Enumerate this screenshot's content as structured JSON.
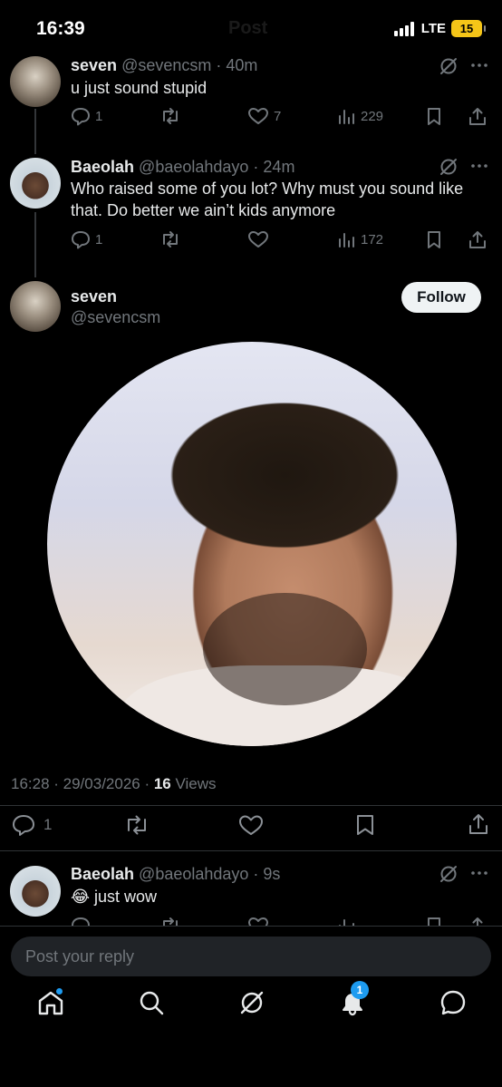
{
  "status_bar": {
    "time": "16:39",
    "network": "LTE",
    "battery": "15",
    "ghost_title": "Post"
  },
  "tweets": [
    {
      "name": "seven",
      "handle": "@sevencsm",
      "time": "40m",
      "text": "u just sound stupid",
      "replies": "1",
      "likes": "7",
      "views": "229"
    },
    {
      "name": "Baeolah",
      "handle": "@baeolahdayo",
      "time": "24m",
      "text": "Who raised some of you lot? Why must you sound like that. Do better we ain’t kids anymore",
      "replies": "1",
      "likes": "",
      "views": "172"
    }
  ],
  "main_post": {
    "name": "seven",
    "handle": "@sevencsm",
    "follow_label": "Follow",
    "timestamp": "16:28 · 29/03/2026 · ",
    "views_count": "16",
    "views_label": " Views",
    "replies": "1"
  },
  "reply": {
    "name": "Baeolah",
    "handle": "@baeolahdayo",
    "time": "9s",
    "text": "😂 just wow"
  },
  "reply_box": {
    "placeholder": "Post your reply"
  },
  "bottom_nav": {
    "notifications_badge": "1"
  },
  "colors": {
    "background": "#000000",
    "muted": "#71767b",
    "accent": "#1d9bf0",
    "text": "#e7e9ea"
  }
}
